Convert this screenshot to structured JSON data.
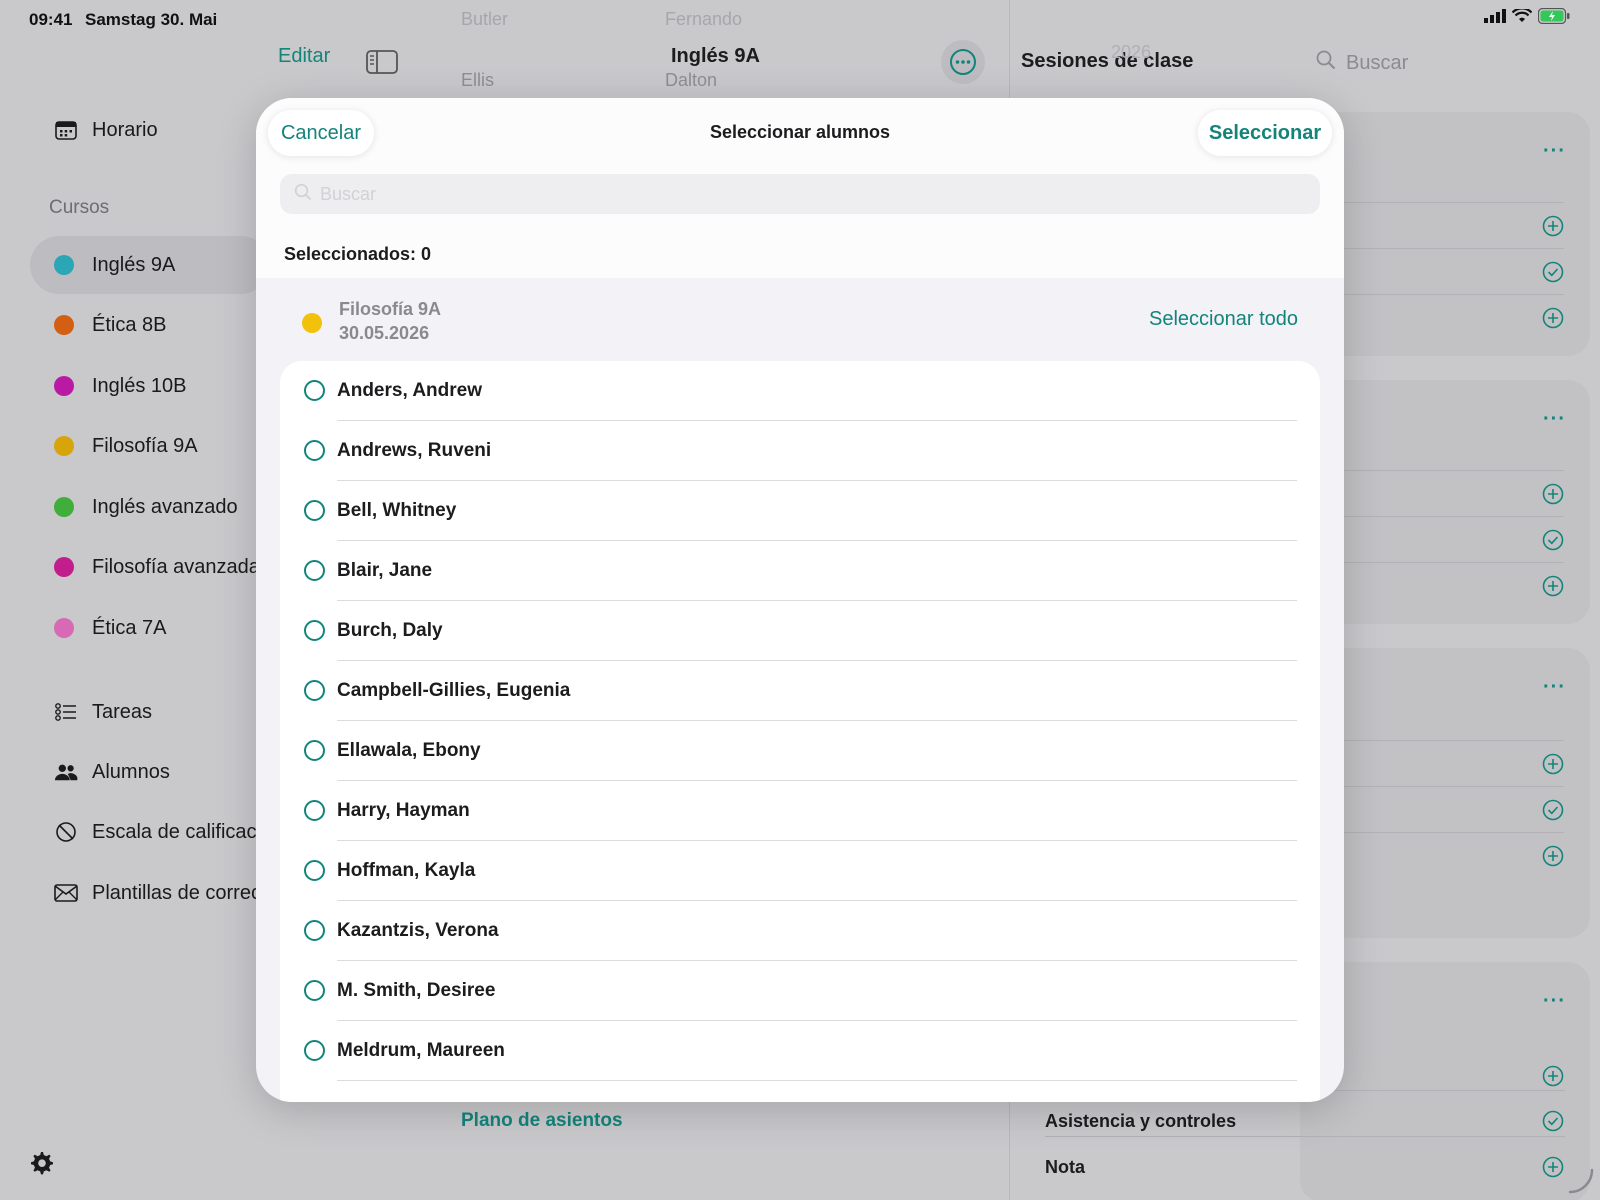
{
  "status_bar": {
    "time": "09:41",
    "date": "Samstag 30. Mai"
  },
  "sidebar": {
    "schedule": "Horario",
    "section_courses": "Cursos",
    "courses": [
      {
        "label": "Inglés 9A",
        "color": "#2aa6b5"
      },
      {
        "label": "Ética 8B",
        "color": "#d35f12"
      },
      {
        "label": "Inglés 10B",
        "color": "#b81aa3"
      },
      {
        "label": "Filosofía 9A",
        "color": "#d8a40c"
      },
      {
        "label": "Inglés avanzado",
        "color": "#3fae3a"
      },
      {
        "label": "Filosofía avanzada",
        "color": "#c11d8c"
      },
      {
        "label": "Ética 7A",
        "color": "#d86ab5"
      }
    ],
    "tools": [
      "Tareas",
      "Alumnos",
      "Escala de calificac",
      "Plantillas de correc"
    ]
  },
  "middle": {
    "edit_label": "Editar",
    "title": "Inglés 9A",
    "ghost_names": [
      "Butler",
      "Fernando",
      "Ellis",
      "Dalton"
    ],
    "seating_plan": "Plano de asientos"
  },
  "right_panel": {
    "title": "Sesiones de clase",
    "search_placeholder": "Buscar",
    "ghost_text": "2026",
    "rows": [
      "Asistencia y controles",
      "Nota"
    ]
  },
  "modal": {
    "cancel_label": "Cancelar",
    "title": "Seleccionar alumnos",
    "confirm_label": "Seleccionar",
    "search_placeholder": "Buscar",
    "selected_count": "Seleccionados: 0",
    "course": {
      "name": "Filosofía 9A",
      "date": "30.05.2026",
      "select_all": "Seleccionar todo",
      "color": "#f2c10c"
    },
    "students": [
      "Anders, Andrew",
      "Andrews, Ruveni",
      "Bell, Whitney",
      "Blair, Jane",
      "Burch, Daly",
      "Campbell-Gillies, Eugenia",
      "Ellawala, Ebony",
      "Harry, Hayman",
      "Hoffman, Kayla",
      "Kazantzis, Verona",
      "M. Smith, Desiree",
      "Meldrum, Maureen"
    ]
  },
  "colors": {
    "accent": "#14847b"
  }
}
